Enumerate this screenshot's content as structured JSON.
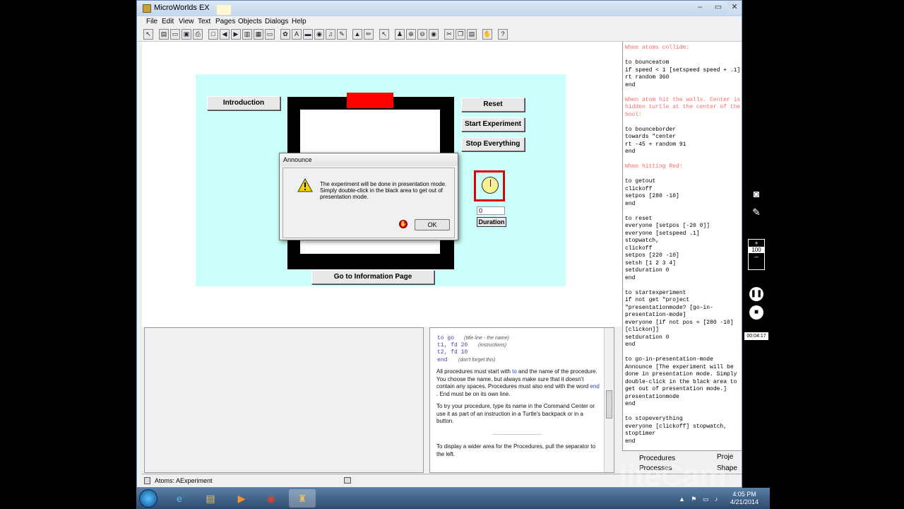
{
  "window": {
    "title": "MicroWorlds EX",
    "controls": {
      "minimize": "–",
      "maximize": "▭",
      "close": "✕"
    }
  },
  "menu": [
    "File",
    "Edit",
    "View",
    "Text",
    "Pages",
    "Objects",
    "Dialogs",
    "Help"
  ],
  "toolbar_icons": [
    "pointer-icon",
    "new-icon",
    "open-icon",
    "save-icon",
    "print-icon",
    "new-page-icon",
    "prev-page-icon",
    "next-page-icon",
    "page-icon",
    "grid-icon",
    "text-box-icon",
    "turtle-icon",
    "text-icon",
    "eye-icon",
    "music-icon",
    "tool-icon",
    "paint-icon",
    "pencil-icon",
    "bucket-icon",
    "arrow-icon",
    "stamp-icon",
    "zoom-in-icon",
    "zoom-out-icon",
    "eye2-icon",
    "cut-icon",
    "copy-icon",
    "paste-icon",
    "stop-icon",
    "help-icon"
  ],
  "page": {
    "buttons": {
      "introduction": "Introduction",
      "reset": "Reset",
      "start": "Start Experiment",
      "stop": "Stop Everything",
      "info": "Go to Information Page",
      "duration": "Duration"
    },
    "counter_value": "0"
  },
  "dialog": {
    "title": "Announce",
    "message": "The experiment will be done in presentation mode. Simply double-click in the black area to get out of presentation mode.",
    "ok": "OK"
  },
  "help": {
    "code": [
      {
        "code": "to go",
        "note": "(title line - the name)"
      },
      {
        "code": "t1, fd 20",
        "note": "(instructions)"
      },
      {
        "code": "t2, fd 10",
        "note": ""
      },
      {
        "code": "end",
        "note": "(don't forget this)"
      }
    ],
    "p1_a": "All procedures must start with ",
    "p1_to": "to",
    "p1_b": " and the name of the procedure. You choose the name, but always make sure that it doesn't contain any spaces. Procedures must also end with the word ",
    "p1_end": "end",
    "p1_c": " . End must be on its own line.",
    "p2": "To try your procedure, type its name in the Command Center or use it as part of an instruction in a Turtle's backpack or in a button.",
    "p3": "To display a wider area for the Procedures, pull the separator to the left."
  },
  "procedures": [
    {
      "t": "When atoms collide:",
      "c": true
    },
    {
      "t": "",
      "c": false
    },
    {
      "t": "to bounceatom",
      "c": false
    },
    {
      "t": "if speed < 1 [setspeed speed + .1]",
      "c": false
    },
    {
      "t": "rt random 360",
      "c": false
    },
    {
      "t": "end",
      "c": false
    },
    {
      "t": "",
      "c": false
    },
    {
      "t": "When atom hit the walls. Center is",
      "c": true
    },
    {
      "t": "hidden turtle at the center of the",
      "c": true
    },
    {
      "t": "bool:",
      "c": true
    },
    {
      "t": "",
      "c": false
    },
    {
      "t": "to bounceborder",
      "c": false
    },
    {
      "t": "towards \"center",
      "c": false
    },
    {
      "t": "rt -45 + random 91",
      "c": false
    },
    {
      "t": "end",
      "c": false
    },
    {
      "t": "",
      "c": false
    },
    {
      "t": "When hitting Red:",
      "c": true
    },
    {
      "t": "",
      "c": false
    },
    {
      "t": "to getout",
      "c": false
    },
    {
      "t": "clickoff",
      "c": false
    },
    {
      "t": "setpos [280 -10]",
      "c": false
    },
    {
      "t": "end",
      "c": false
    },
    {
      "t": "",
      "c": false
    },
    {
      "t": "to reset",
      "c": false
    },
    {
      "t": "everyone [setpos [-20 0]]",
      "c": false
    },
    {
      "t": "everyone [setspeed .1]",
      "c": false
    },
    {
      "t": "stopwatch,",
      "c": false
    },
    {
      "t": "clickoff",
      "c": false
    },
    {
      "t": "setpos [220 -10]",
      "c": false
    },
    {
      "t": "setsh [1 2 3 4]",
      "c": false
    },
    {
      "t": "setduration 0",
      "c": false
    },
    {
      "t": "end",
      "c": false
    },
    {
      "t": "",
      "c": false
    },
    {
      "t": "to startexperiment",
      "c": false
    },
    {
      "t": "if not get \"project",
      "c": false
    },
    {
      "t": "\"presentationmode? [go-in-",
      "c": false
    },
    {
      "t": "presentation-mode]",
      "c": false
    },
    {
      "t": "everyone [if not pos = [280 -10]",
      "c": false
    },
    {
      "t": "[clickon]]",
      "c": false
    },
    {
      "t": "setduration 0",
      "c": false
    },
    {
      "t": "end",
      "c": false
    },
    {
      "t": "",
      "c": false
    },
    {
      "t": "to go-in-presentation-mode",
      "c": false
    },
    {
      "t": "Announce [The experiment will be",
      "c": false
    },
    {
      "t": "done in presentation mode. Simply",
      "c": false
    },
    {
      "t": "double-click in the black area to",
      "c": false
    },
    {
      "t": "get out of presentation mode.]",
      "c": false
    },
    {
      "t": "presentationmode",
      "c": false
    },
    {
      "t": "end",
      "c": false
    },
    {
      "t": "",
      "c": false
    },
    {
      "t": "to stopeverything",
      "c": false
    },
    {
      "t": "everyone [clickoff] stopwatch,",
      "c": false
    },
    {
      "t": "stoptimer",
      "c": false
    },
    {
      "t": "end",
      "c": false
    }
  ],
  "tabs": {
    "procedures": "Procedures",
    "project": "Proje",
    "processes": "Processes",
    "shapes": "Shape"
  },
  "statusbar": {
    "text": "Atoms:  AExperiment"
  },
  "taskbar": {
    "time": "4:05 PM",
    "date": "4/21/2014"
  },
  "recorder": {
    "zoom_plus": "+",
    "zoom_value": "100",
    "zoom_minus": "–",
    "elapsed": "00:04:17",
    "watermark": "liteCam"
  },
  "colors": {
    "stage": "#ccfffb",
    "red_target": "#ff0000",
    "comment": "#ff6a6a",
    "keyword": "#2244cc"
  }
}
